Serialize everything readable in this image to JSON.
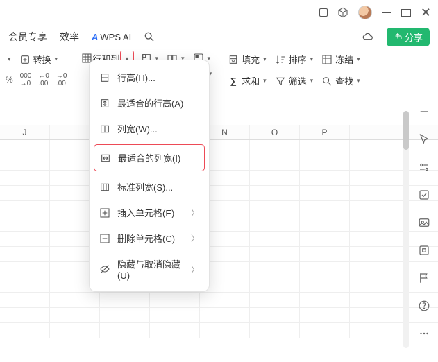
{
  "titlebar": {},
  "menurow": {
    "member": "会员专享",
    "efficiency": "效率",
    "ai": "WPS AI",
    "share": "分享"
  },
  "ribbon": {
    "convert": "转换",
    "rowcol": "行和列",
    "fill": "填充",
    "sort": "排序",
    "freeze": "冻结",
    "sum": "求和",
    "filter": "筛选",
    "find": "查找",
    "pct": "%",
    "dec1": ".00",
    "dec2": ".0",
    "dec3": ".00"
  },
  "dropdown": {
    "rowHeight": "行高(H)...",
    "fitRowHeight": "最适合的行高(A)",
    "colWidth": "列宽(W)...",
    "fitColWidth": "最适合的列宽(I)",
    "stdColWidth": "标准列宽(S)...",
    "insertCells": "插入单元格(E)",
    "deleteCells": "删除单元格(C)",
    "hideUnhide": "隐藏与取消隐藏(U)"
  },
  "columns": [
    "J",
    "",
    "",
    "",
    "N",
    "O",
    "P"
  ]
}
